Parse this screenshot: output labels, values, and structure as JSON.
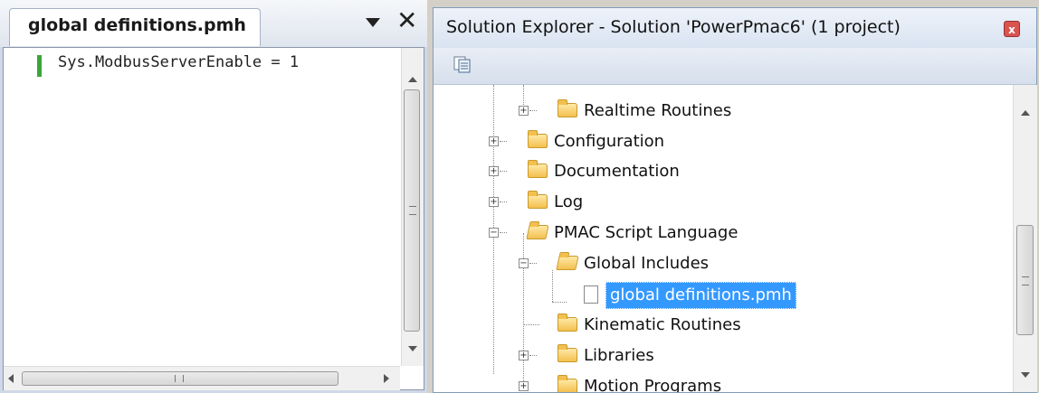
{
  "editor": {
    "tab_label": "global definitions.pmh",
    "close_glyph": "✕",
    "code_line": "Sys.ModbusServerEnable = 1"
  },
  "solution_explorer": {
    "title": "Solution Explorer - Solution 'PowerPmac6' (1 project)",
    "tree": [
      {
        "label": "Realtime Routines",
        "expander": "+",
        "icon": "folder-closed"
      },
      {
        "label": "Configuration",
        "expander": "+",
        "icon": "folder-closed"
      },
      {
        "label": "Documentation",
        "expander": "+",
        "icon": "folder-closed"
      },
      {
        "label": "Log",
        "expander": "+",
        "icon": "folder-closed"
      },
      {
        "label": "PMAC Script Language",
        "expander": "−",
        "icon": "folder-open"
      },
      {
        "label": "Global Includes",
        "expander": "−",
        "icon": "folder-open"
      },
      {
        "label": "global definitions.pmh",
        "expander": "",
        "icon": "file",
        "selected": true
      },
      {
        "label": "Kinematic Routines",
        "expander": "",
        "icon": "folder-closed"
      },
      {
        "label": "Libraries",
        "expander": "+",
        "icon": "folder-closed"
      },
      {
        "label": "Motion Programs",
        "expander": "+",
        "icon": "folder-closed"
      }
    ]
  },
  "colors": {
    "selection": "#3399ff",
    "modified_line": "#3aa63a"
  }
}
